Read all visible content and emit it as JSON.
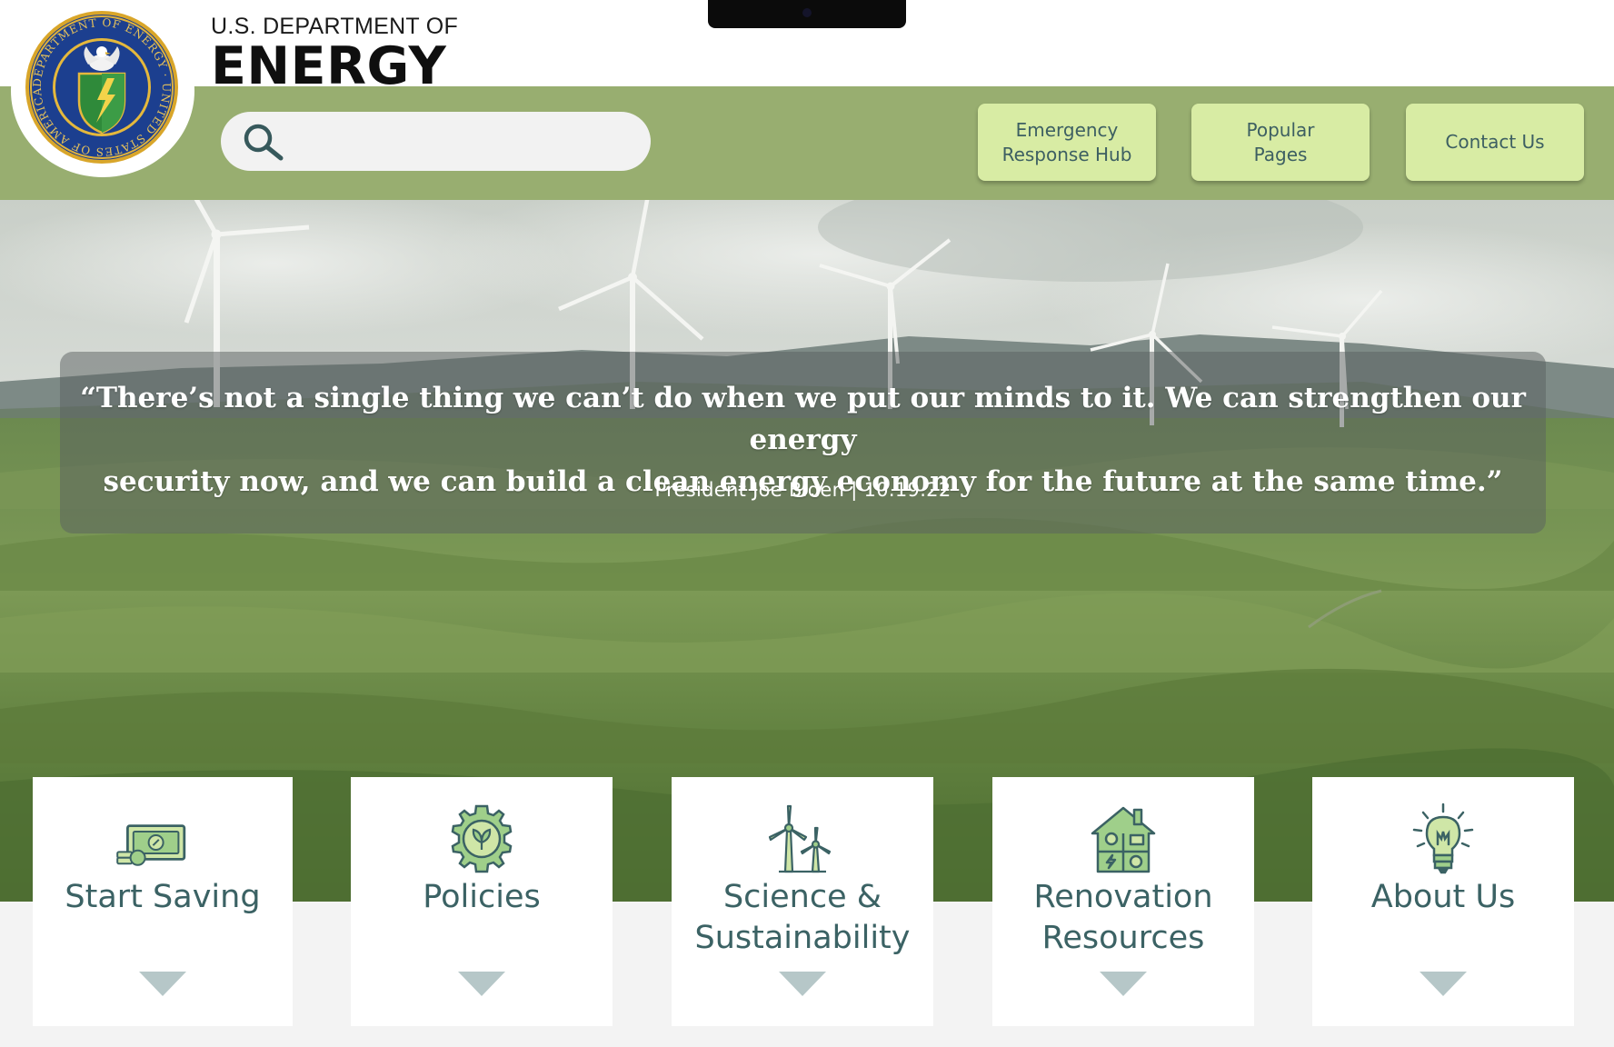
{
  "header": {
    "agency_small": "U.S. DEPARTMENT OF",
    "agency_big": "ENERGY",
    "seal_text": "DEPARTMENT OF ENERGY · UNITED STATES OF AMERICA"
  },
  "search": {
    "icon": "search-icon",
    "placeholder": ""
  },
  "nav": {
    "emergency_line1": "Emergency",
    "emergency_line2": "Response Hub",
    "popular_line1": "Popular",
    "popular_line2": "Pages",
    "contact": "Contact Us"
  },
  "hero": {
    "quote_line1": "“There’s not a single thing we can’t do when we put our minds to it.  We can strengthen our energy",
    "quote_line2": "security now, and we can build a clean energy economy for the future at the same time.”",
    "attribution": "President Joe Biden  |  10.19.22"
  },
  "cards": [
    {
      "title": "Start Saving",
      "icon": "money-icon"
    },
    {
      "title": "Policies",
      "icon": "gear-leaf-icon"
    },
    {
      "title_line1": "Science &",
      "title_line2": "Sustainability",
      "icon": "wind-turbine-icon"
    },
    {
      "title_line1": "Renovation",
      "title_line2": "Resources",
      "icon": "smart-house-icon"
    },
    {
      "title": "About Us",
      "icon": "lightbulb-icon"
    }
  ],
  "colors": {
    "nav_green": "#98ae70",
    "button_green": "#d8eca4",
    "text_teal": "#3b6264",
    "arrow": "#b6c7c8"
  }
}
